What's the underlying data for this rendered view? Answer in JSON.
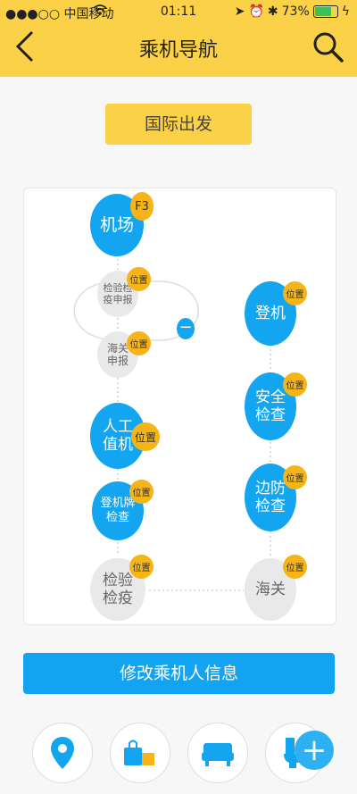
{
  "status_bar": {
    "carrier": "●●●○○ 中国移动",
    "time": "01:11",
    "battery": "73%"
  },
  "nav": {
    "title": "乘机导航"
  },
  "departure_button": "国际出发",
  "flow": {
    "left": [
      {
        "label": "机场",
        "badge": "F3",
        "style": "blue"
      },
      {
        "label": "检验检\n疫申报",
        "badge": "位置",
        "style": "gray"
      },
      {
        "label": "海关\n申报",
        "badge": "位置",
        "style": "gray"
      },
      {
        "label": "人工\n值机",
        "badge": "位置",
        "style": "blue"
      },
      {
        "label": "登机牌\n检查",
        "badge": "位置",
        "style": "blue"
      },
      {
        "label": "检验\n检疫",
        "badge": "位置",
        "style": "gray"
      }
    ],
    "right": [
      {
        "label": "登机",
        "badge": "位置",
        "style": "blue"
      },
      {
        "label": "安全\n检查",
        "badge": "位置",
        "style": "blue"
      },
      {
        "label": "边防\n检查",
        "badge": "位置",
        "style": "blue"
      },
      {
        "label": "海关",
        "badge": "位置",
        "style": "gray"
      }
    ],
    "collapse_symbol": "−"
  },
  "edit_button": "修改乘机人信息",
  "bottom_icons": [
    "location-pin-icon",
    "shop-bag-icon",
    "lounge-sofa-icon",
    "toilet-icon"
  ],
  "fab_symbol": "+",
  "colors": {
    "accent_yellow": "#fbd247",
    "accent_blue": "#13a5f0",
    "badge_orange": "#f6b416",
    "gray_node": "#e9e9e9"
  }
}
